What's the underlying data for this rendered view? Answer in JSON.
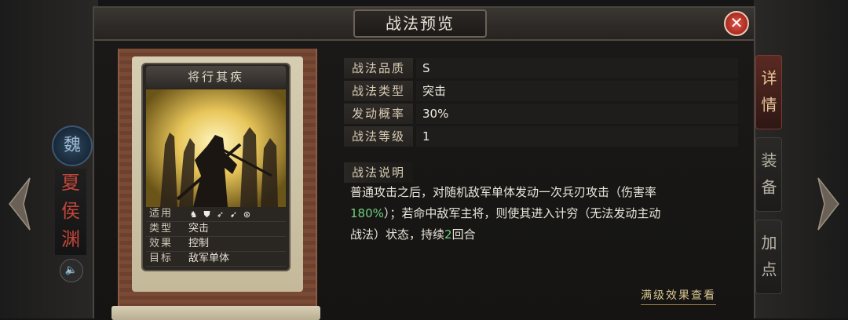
{
  "dialog": {
    "title": "战法预览",
    "close_label": "✕"
  },
  "hero": {
    "faction": "魏",
    "name_chars": [
      "夏",
      "侯",
      "渊"
    ],
    "sound_icon": "🔈"
  },
  "side_tabs": [
    "详情",
    "装备",
    "加点"
  ],
  "card": {
    "title": "将行其疾",
    "suitable_label": "适用",
    "type_label": "类型",
    "type_value": "突击",
    "effect_label": "效果",
    "effect_value": "控制",
    "target_label": "目标",
    "target_value": "敌军单体"
  },
  "attributes": [
    {
      "label": "战法品质",
      "value": "S"
    },
    {
      "label": "战法类型",
      "value": "突击"
    },
    {
      "label": "发动概率",
      "value": "30%"
    },
    {
      "label": "战法等级",
      "value": "1"
    }
  ],
  "description": {
    "label": "战法说明",
    "line1": "普通攻击之后，对随机敌军单体发动一次兵刃攻击（伤害率",
    "highlight1": "180%",
    "line2_rest": "）；若命中敌军主将，则使其进入计穷（无法发动主动",
    "line3_start": "战法）状态，持续",
    "highlight2": "2",
    "line3_end": "回合"
  },
  "more_link": "满级效果查看",
  "colors": {
    "highlight": "#6fcf7e",
    "hero_name": "#c0463a",
    "close_button": "#c0392b"
  }
}
